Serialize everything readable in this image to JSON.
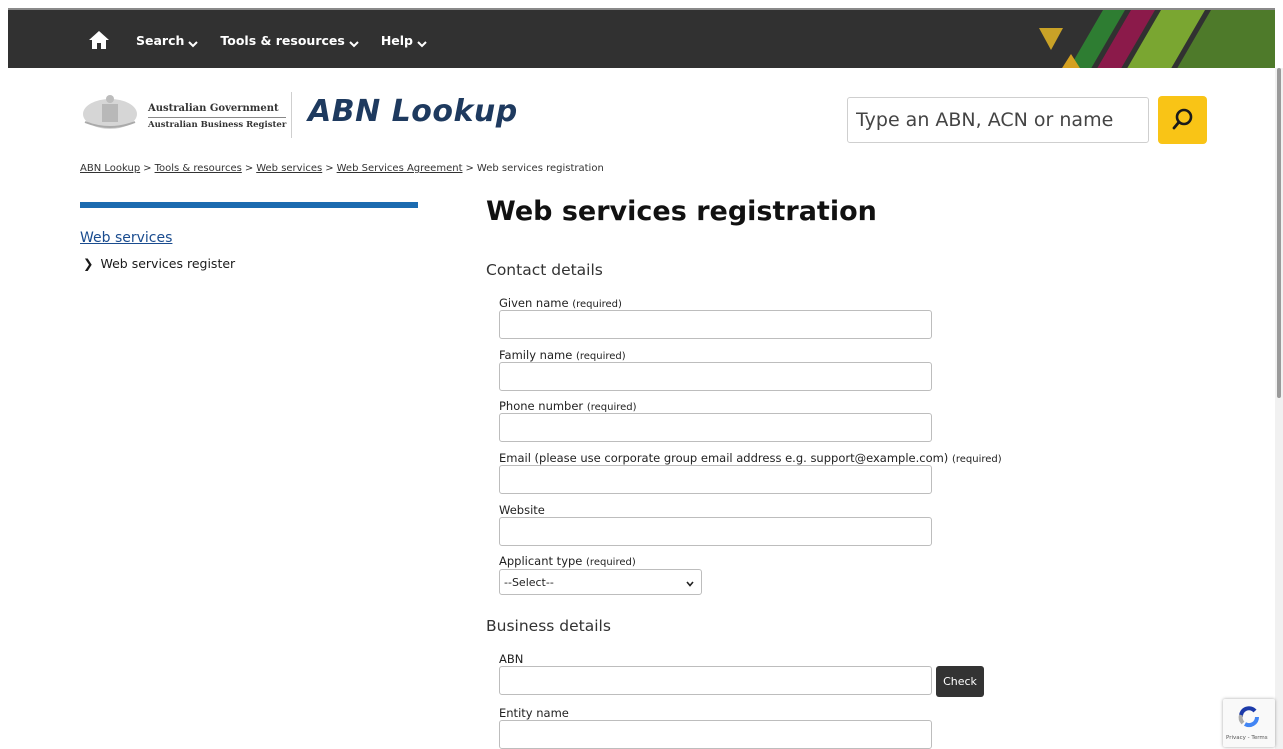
{
  "nav": {
    "items": [
      {
        "label": "Search"
      },
      {
        "label": "Tools & resources"
      },
      {
        "label": "Help"
      }
    ]
  },
  "header": {
    "gov_line1": "Australian Government",
    "gov_line2": "Australian Business Register",
    "site_title": "ABN Lookup",
    "search_placeholder": "Type an ABN, ACN or name"
  },
  "breadcrumb": [
    {
      "label": "ABN Lookup"
    },
    {
      "label": "Tools & resources"
    },
    {
      "label": "Web services"
    },
    {
      "label": "Web Services Agreement"
    },
    {
      "label": "Web services registration"
    }
  ],
  "sidebar": {
    "title": "Web services",
    "item": "Web services register"
  },
  "main": {
    "title": "Web services registration",
    "contact_heading": "Contact details",
    "business_heading": "Business details",
    "fields": {
      "given": {
        "label": "Given name",
        "req": "(required)",
        "value": ""
      },
      "family": {
        "label": "Family name",
        "req": "(required)",
        "value": ""
      },
      "phone": {
        "label": "Phone number",
        "req": "(required)",
        "value": ""
      },
      "email": {
        "label": "Email (please use corporate group email address e.g. support@example.com)",
        "req": "(required)",
        "value": ""
      },
      "website": {
        "label": "Website",
        "value": ""
      },
      "applicant": {
        "label": "Applicant type",
        "req": "(required)",
        "selected": "--Select--"
      },
      "abn": {
        "label": "ABN",
        "value": ""
      },
      "entity": {
        "label": "Entity name",
        "value": ""
      }
    },
    "check_label": "Check"
  },
  "recaptcha": {
    "text": "Privacy - Terms"
  },
  "colors": {
    "topbar": "#313131",
    "accent_yellow": "#f9c416",
    "sidebar_bar": "#1b6bb0",
    "title_blue": "#1e3a5f"
  }
}
